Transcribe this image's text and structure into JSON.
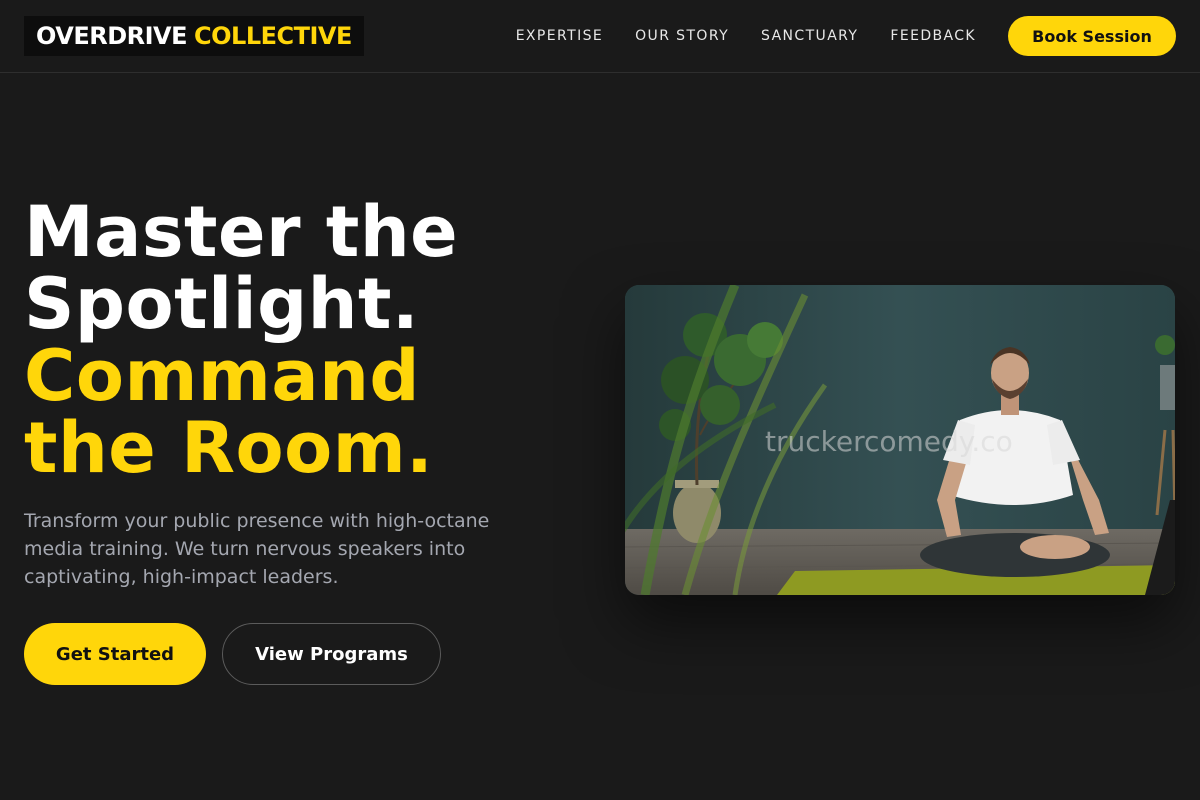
{
  "header": {
    "logo": {
      "primary": "OVERDRIVE",
      "accent": "COLLECTIVE"
    },
    "nav": [
      {
        "label": "EXPERTISE"
      },
      {
        "label": "OUR STORY"
      },
      {
        "label": "SANCTUARY"
      },
      {
        "label": "FEEDBACK"
      }
    ],
    "cta_label": "Book Session"
  },
  "hero": {
    "headline": [
      "Master the",
      "Spotlight."
    ],
    "headline_accent": [
      "Command",
      "the Room."
    ],
    "description": "Transform your public presence with high-octane media training. We turn nervous speakers into captivating, high-impact leaders.",
    "primary_cta": "Get Started",
    "secondary_cta": "View Programs"
  },
  "media": {
    "watermark": "truckercomedy.co",
    "image_subject": "man meditating cross-legged on a yoga mat beside plants"
  },
  "colors": {
    "background": "#1a1a1a",
    "accent": "#ffd60a",
    "text": "#ffffff",
    "muted": "#a4a7b0"
  }
}
